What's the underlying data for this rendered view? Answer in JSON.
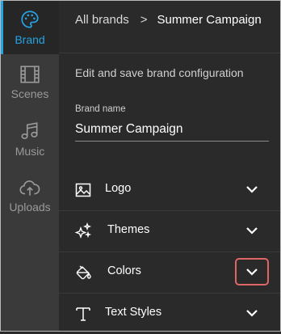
{
  "sidebar": {
    "items": [
      {
        "label": "Brand",
        "icon": "palette-icon",
        "active": true
      },
      {
        "label": "Scenes",
        "icon": "film-icon",
        "active": false
      },
      {
        "label": "Music",
        "icon": "music-note-icon",
        "active": false
      },
      {
        "label": "Uploads",
        "icon": "cloud-upload-icon",
        "active": false
      }
    ]
  },
  "breadcrumb": {
    "parent": "All brands",
    "separator": ">",
    "current": "Summer Campaign"
  },
  "main": {
    "description": "Edit and save brand configuration",
    "brand_name": {
      "label": "Brand name",
      "value": "Summer Campaign"
    },
    "sections": [
      {
        "label": "Logo",
        "icon": "image-icon"
      },
      {
        "label": "Themes",
        "icon": "sparkles-icon"
      },
      {
        "label": "Colors",
        "icon": "paint-bucket-icon"
      },
      {
        "label": "Text Styles",
        "icon": "text-icon"
      }
    ]
  },
  "colors": {
    "accent": "#25a3e2",
    "highlight": "#e06666",
    "rail_bg": "#3a3a3a",
    "panel_bg": "#2a2a2a"
  }
}
